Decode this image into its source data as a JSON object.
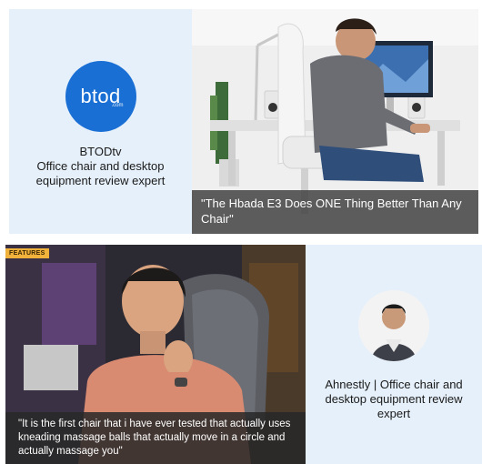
{
  "cards": {
    "top_left": {
      "logo_text": "btod",
      "logo_subtext": ".com",
      "name": "BTODtv",
      "description": "Office chair and desktop equipment review expert",
      "logo_color": "#1a6fd4",
      "background": "#e6f0fa"
    },
    "top_right_video": {
      "caption": "\"The Hbada E3 Does ONE Thing Better Than Any Chair\""
    },
    "bottom_left_video": {
      "tag": "FEATURES",
      "caption": "\"It is the first chair that i have ever tested that actually uses kneading massage balls that actually move in a circle and actually massage you\""
    },
    "bottom_right": {
      "reviewer": "Ahnestly",
      "separator": "|",
      "description": "Office chair and desktop equipment review expert"
    }
  }
}
